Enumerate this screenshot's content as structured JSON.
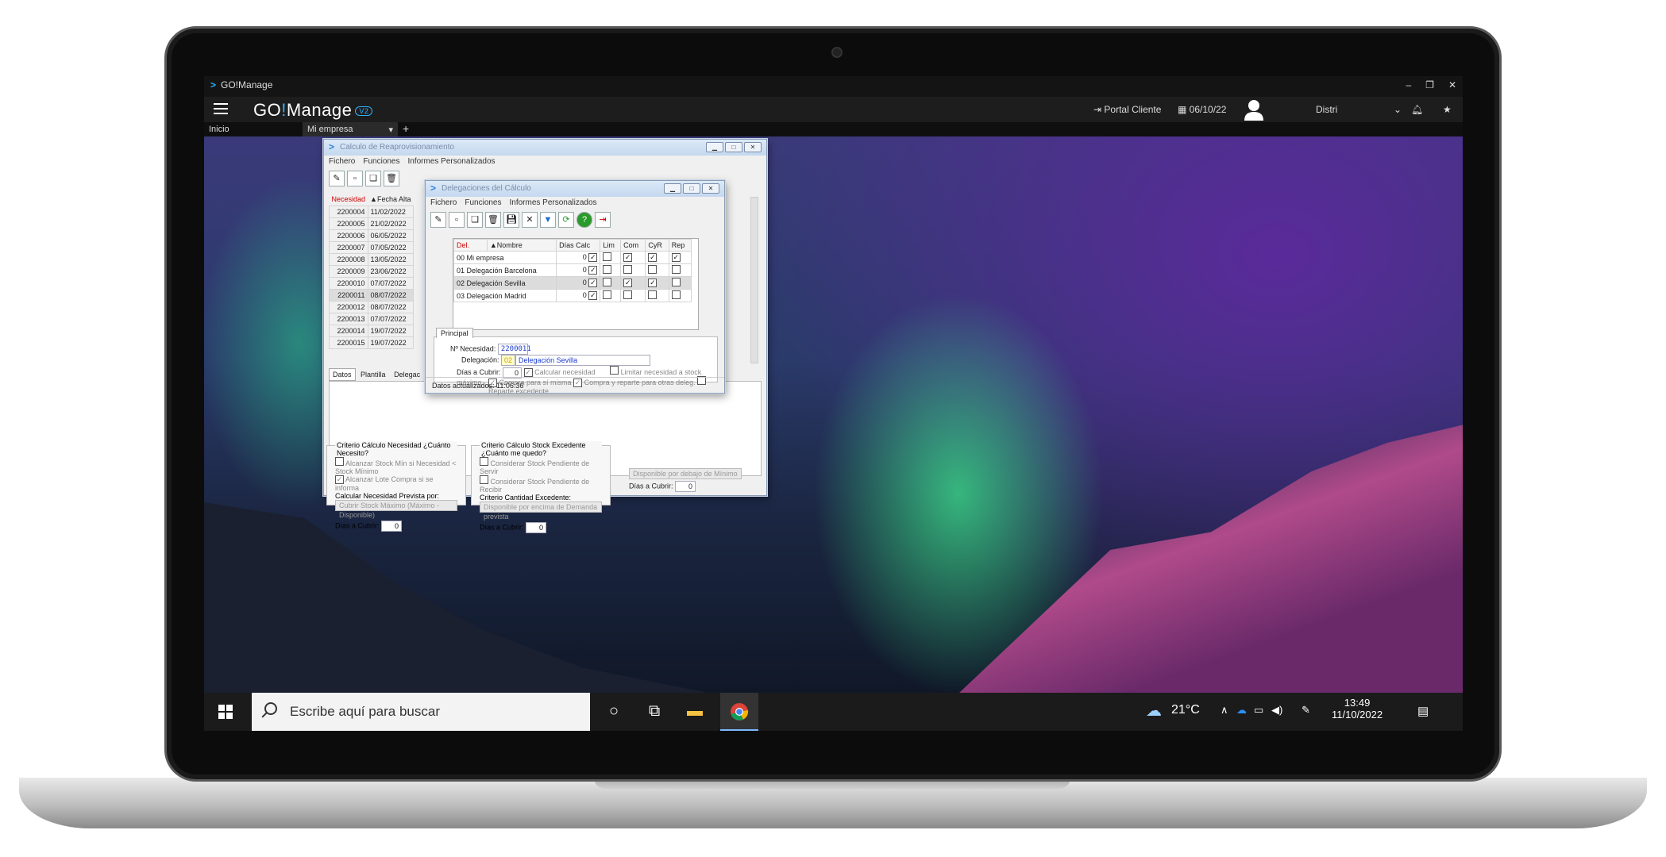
{
  "app": {
    "title": "GO!Manage",
    "logo_main": "GO",
    "logo_bang": "!",
    "logo_rest": "Manage",
    "logo_badge": "V2"
  },
  "header": {
    "portal": "Portal Cliente",
    "date": "06/10/22",
    "user": "Distri"
  },
  "tabs": [
    {
      "label": "Inicio"
    },
    {
      "label": "Mi empresa"
    }
  ],
  "win1": {
    "title": "Calculo de Reaprovisionamiento",
    "menu": [
      "Fichero",
      "Funciones",
      "Informes Personalizados"
    ],
    "col_necesidad": "Necesidad",
    "col_fecha": "Fecha Alta",
    "rows": [
      [
        "2200004",
        "11/02/2022"
      ],
      [
        "2200005",
        "21/02/2022"
      ],
      [
        "2200006",
        "06/05/2022"
      ],
      [
        "2200007",
        "07/05/2022"
      ],
      [
        "2200008",
        "13/05/2022"
      ],
      [
        "2200009",
        "23/06/2022"
      ],
      [
        "2200010",
        "07/07/2022"
      ],
      [
        "2200011",
        "08/07/2022"
      ],
      [
        "2200012",
        "08/07/2022"
      ],
      [
        "2200013",
        "07/07/2022"
      ],
      [
        "2200014",
        "19/07/2022"
      ],
      [
        "2200015",
        "19/07/2022"
      ]
    ],
    "tabs": [
      "Datos",
      "Plantilla",
      "Delegac"
    ],
    "grp1_title": "Criterio Cálculo Necesidad ¿Cuánto Necesito?",
    "grp1_opt1": "Alcanzar Stock Mín si Necesidad < Stock Mínimo",
    "grp1_opt2": "Alcanzar Lote Compra si se informa",
    "grp1_label": "Calcular Necesidad Prevista por:",
    "grp1_combo": "Cubrir Stock Máximo (Máximo - Disponible)",
    "dias_label": "Días a Cubrir:",
    "dias_val": "0",
    "grp2_title": "Criterio Cálculo Stock Excedente ¿Cuánto me quedo?",
    "grp2_opt1": "Considerar Stock Pendiente de Servir",
    "grp2_opt2": "Considerar Stock Pendiente de Recibir",
    "grp2_label": "Criterio Cantidad Excedente:",
    "grp2_combo": "Disponible por encima de Demanda prevista",
    "top_combo": "Disponible por debajo de Mínimo"
  },
  "win2": {
    "title": "Delegaciones del Cálculo",
    "menu": [
      "Fichero",
      "Funciones",
      "Informes Personalizados"
    ],
    "cols": [
      "Del.",
      "Nombre",
      "Días Calc",
      "Lim",
      "Com",
      "CyR",
      "Rep"
    ],
    "rows": [
      {
        "del": "00",
        "nombre": "Mi empresa",
        "dias": "0",
        "lim": "✓",
        "com": "",
        "cyr": "✓",
        "cyr2": "✓",
        "rep": "✓"
      },
      {
        "del": "01",
        "nombre": "Delegación Barcelona",
        "dias": "0",
        "lim": "✓",
        "com": "",
        "cyr": "",
        "cyr2": "",
        "rep": ""
      },
      {
        "del": "02",
        "nombre": "Delegación Sevilla",
        "dias": "0",
        "lim": "✓",
        "com": "",
        "cyr": "✓",
        "cyr2": "✓",
        "rep": ""
      },
      {
        "del": "03",
        "nombre": "Delegación Madrid",
        "dias": "0",
        "lim": "✓",
        "com": "",
        "cyr": "",
        "cyr2": "",
        "rep": ""
      }
    ],
    "tab": "Principal",
    "lbl_necesidad": "Nº Necesidad:",
    "val_necesidad": "2200011",
    "lbl_delegacion": "Delegación:",
    "val_del_code": "02",
    "val_del_name": "Delegación Sevilla",
    "lbl_dias": "Días a Cubrir:",
    "val_dias": "0",
    "opt_calc": "Calcular necesidad",
    "opt_lim": "Limitar necesidad a stock máximo",
    "opt_compra": "Compra para sí misma",
    "opt_reparte": "Compra y reparte para otras deleg.",
    "opt_exc": "Reparte excedente",
    "status": "Datos actualizados: 11:06:36"
  },
  "taskbar": {
    "search": "Escribe aquí para buscar",
    "temp": "21°C",
    "time": "13:49",
    "date": "11/10/2022"
  }
}
